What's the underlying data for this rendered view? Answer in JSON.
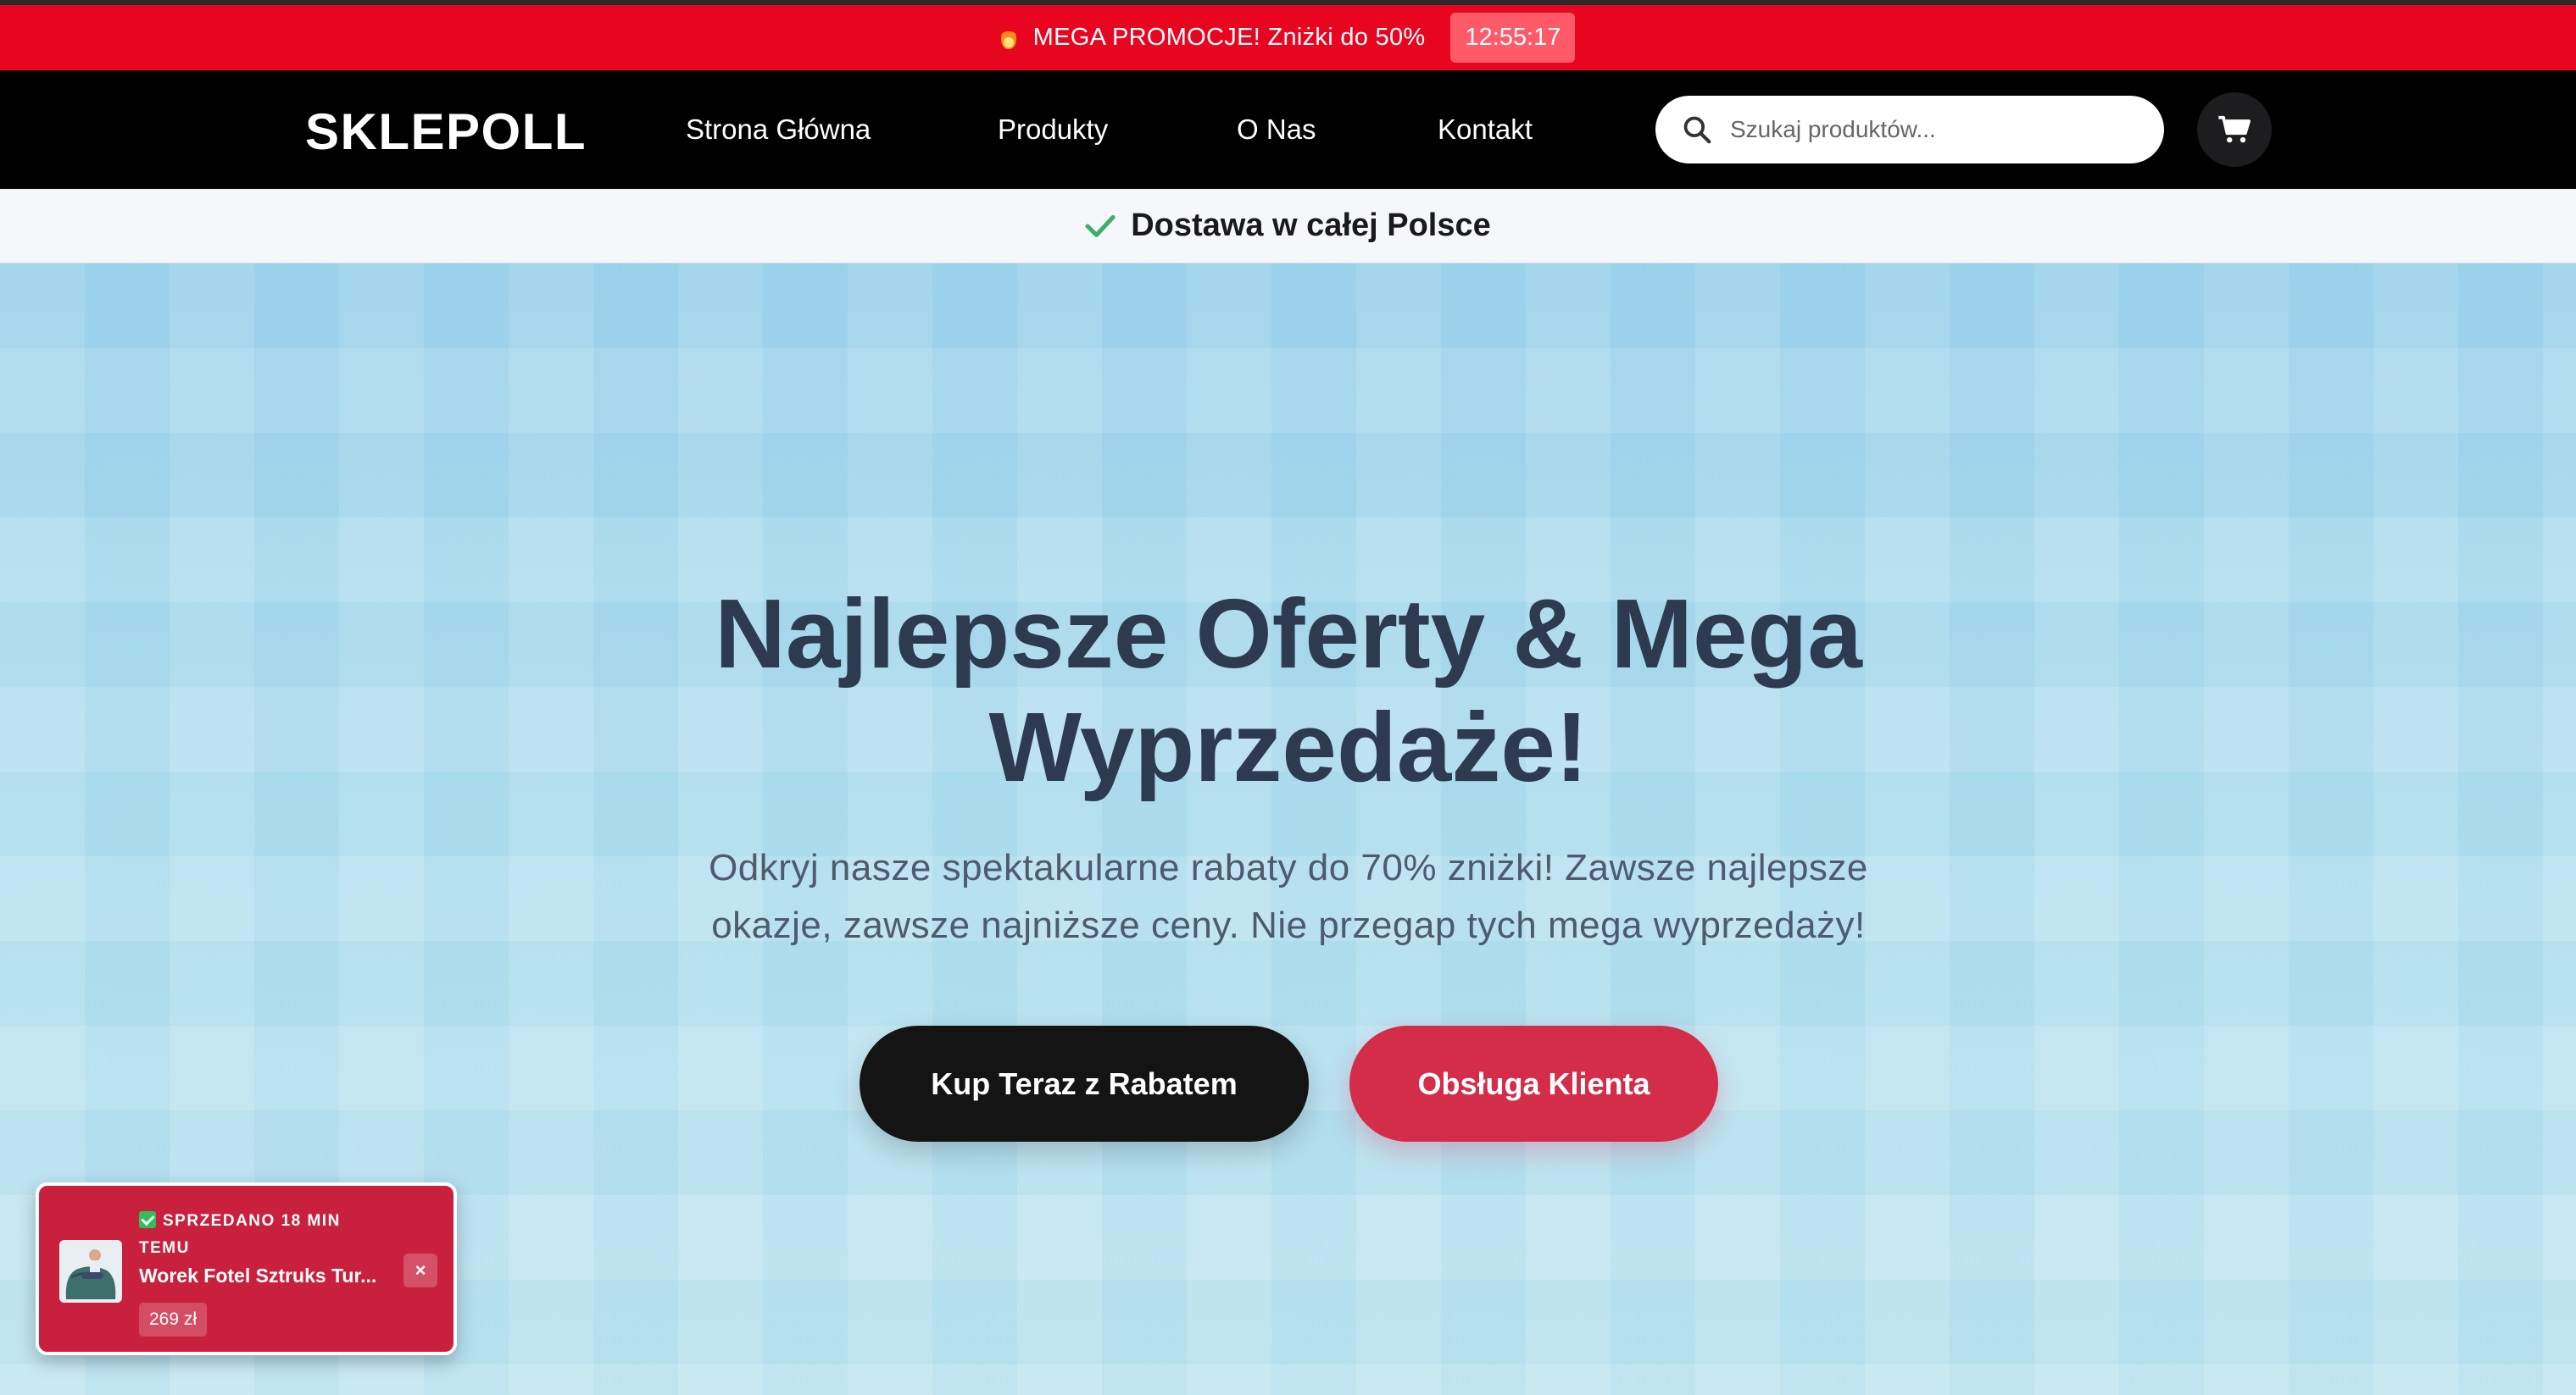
{
  "promo_bar": {
    "icon": "fire-icon",
    "text": "MEGA PROMOCJE! Zniżki do 50%",
    "timer": "12:55:17",
    "background": "#e8051f"
  },
  "header": {
    "logo": "SKLEPOLL",
    "nav": [
      {
        "label": "Strona Główna"
      },
      {
        "label": "Produkty"
      },
      {
        "label": "O Nas"
      },
      {
        "label": "Kontakt"
      }
    ],
    "search": {
      "placeholder": "Szukaj produktów...",
      "icon": "search-icon"
    },
    "cart": {
      "icon": "cart-icon"
    }
  },
  "delivery": {
    "icon": "check-icon",
    "text": "Dostawa w całej Polsce"
  },
  "hero": {
    "title_line1": "Najlepsze Oferty & Mega",
    "title_line2": "Wyprzedaże!",
    "subtitle_line1": "Odkryj nasze spektakularne rabaty do 70% zniżki! Zawsze najlepsze",
    "subtitle_line2": "okazje, zawsze najniższe ceny. Nie przegap tych mega wyprzedaży!",
    "primary_button": "Kup Teraz z Rabatem",
    "secondary_button": "Obsługa Klienta",
    "primary_color": "#141414",
    "secondary_color": "#d42d4a"
  },
  "sale_toast": {
    "status": "SPRZEDANO 18 MIN TEMU",
    "product": "Worek Fotel Sztruks Tur...",
    "price": "269 zł",
    "close_label": "×",
    "background": "#c9213d"
  }
}
